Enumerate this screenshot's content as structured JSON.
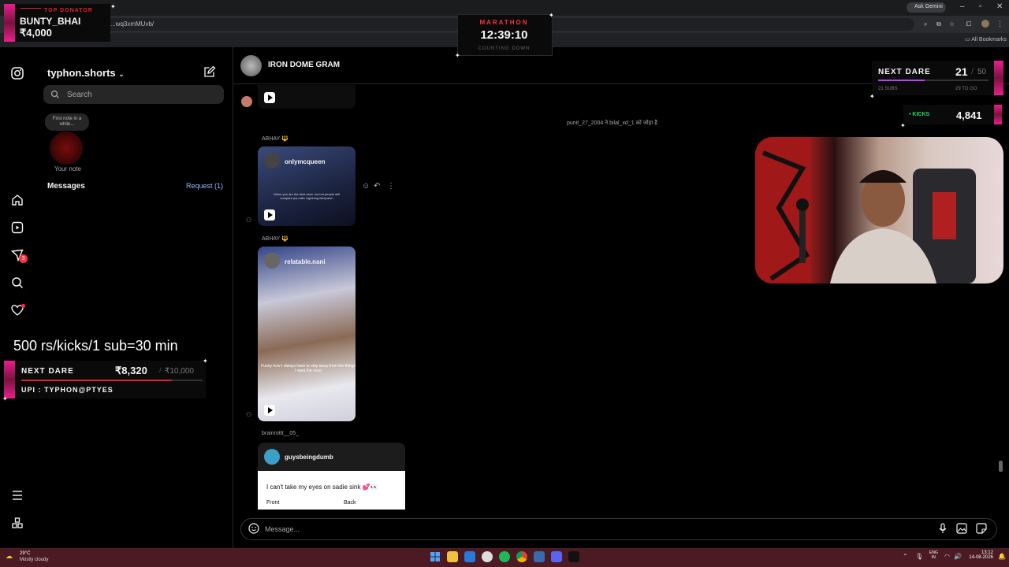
{
  "browser": {
    "url_fragment": "...wq3xmMUvb/",
    "ask_gemini": "Ask Gemini",
    "all_bookmarks": "All Bookmarks",
    "win_min": "–",
    "win_max": "▫",
    "win_close": "✕"
  },
  "overlays": {
    "top_donator": {
      "label": "TOP DONATOR",
      "name": "BUNTY_BHAI",
      "amount": "₹4,000"
    },
    "marathon": {
      "title": "MARATHON",
      "time": "12:39:10",
      "subtitle": "COUNTING DOWN"
    },
    "next_dare_top": {
      "label": "NEXT DARE",
      "current": "21",
      "goal": "50",
      "sub_label": "21 SUBS",
      "to_go": "29 TO GO"
    },
    "kicks": {
      "label": "KICKS",
      "value": "4,841"
    },
    "rates": "500 rs/kicks/1 sub=30 min",
    "next_dare_bottom": {
      "label": "NEXT DARE",
      "amount": "₹8,320",
      "goal": "₹10,000",
      "upi": "UPI : TYPHON@PTYES"
    }
  },
  "sidebar": {
    "username": "typhon.shorts",
    "search_placeholder": "Search",
    "note_bubble": "First note in a while...",
    "your_note": "Your note",
    "messages_label": "Messages",
    "requests_label": "Request (1)"
  },
  "rail": {
    "notification_count": "3"
  },
  "chat": {
    "title": "IRON DOME GRAM",
    "system_message": "punit_27_2004 ने bilal_xd_1 को जोड़ा है",
    "messages": [
      {
        "sender": "ABHAY 🔱",
        "reel_account": "onlymcqueen",
        "caption": "When you are the best racer out but people still compare you with Lightning McQueen"
      },
      {
        "sender": "ABHAY 🔱",
        "reel_account": "relatable.nani",
        "caption": "Funny how I always have to stay away from the things I want the most"
      },
      {
        "sender": "brainrottt__05_",
        "post_account": "guysbeingdumb",
        "post_text": "I can't take my eyes on sadie sink 💕👀",
        "front_label": "Front",
        "back_label": "Back"
      }
    ],
    "composer_placeholder": "Message..."
  },
  "taskbar": {
    "weather_temp": "29°C",
    "weather_desc": "Mostly cloudy",
    "lang_top": "ENG",
    "lang_bottom": "IN",
    "time": "13:12",
    "date": "14-08-2026"
  }
}
